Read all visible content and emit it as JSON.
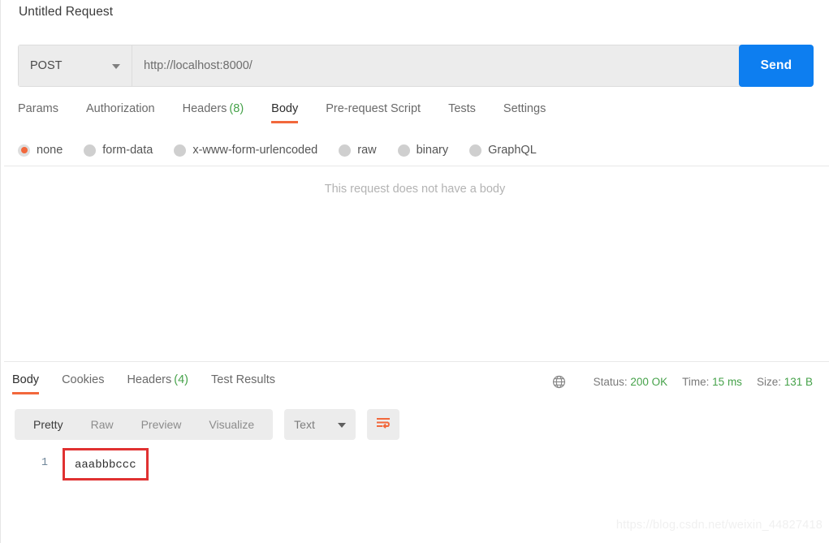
{
  "request": {
    "title": "Untitled Request",
    "method": "POST",
    "method_caret": "chevron-down-icon",
    "url": "http://localhost:8000/",
    "send_label": "Send",
    "send_color": "#0d7ef0",
    "tabs": [
      {
        "label": "Params",
        "count": "",
        "active": false
      },
      {
        "label": "Authorization",
        "count": "",
        "active": false
      },
      {
        "label": "Headers",
        "count": "(8)",
        "active": false
      },
      {
        "label": "Body",
        "count": "",
        "active": true
      },
      {
        "label": "Pre-request Script",
        "count": "",
        "active": false
      },
      {
        "label": "Tests",
        "count": "",
        "active": false
      },
      {
        "label": "Settings",
        "count": "",
        "active": false
      }
    ],
    "body_types": [
      {
        "label": "none",
        "selected": true
      },
      {
        "label": "form-data",
        "selected": false
      },
      {
        "label": "x-www-form-urlencoded",
        "selected": false
      },
      {
        "label": "raw",
        "selected": false
      },
      {
        "label": "binary",
        "selected": false
      },
      {
        "label": "GraphQL",
        "selected": false
      }
    ],
    "empty_body_message": "This request does not have a body"
  },
  "response": {
    "tabs": [
      {
        "label": "Body",
        "count": "",
        "active": true
      },
      {
        "label": "Cookies",
        "count": "",
        "active": false
      },
      {
        "label": "Headers",
        "count": "(4)",
        "active": false
      },
      {
        "label": "Test Results",
        "count": "",
        "active": false
      }
    ],
    "meta": {
      "globe_icon": "globe-icon",
      "status_label": "Status:",
      "status_value": "200 OK",
      "time_label": "Time:",
      "time_value": "15 ms",
      "size_label": "Size:",
      "size_value": "131 B",
      "value_color": "#46a24a"
    },
    "viewer": {
      "modes": [
        {
          "label": "Pretty",
          "active": true
        },
        {
          "label": "Raw",
          "active": false
        },
        {
          "label": "Preview",
          "active": false
        },
        {
          "label": "Visualize",
          "active": false
        }
      ],
      "format": "Text",
      "format_caret": "chevron-down-icon",
      "wrap_icon": "word-wrap-icon"
    },
    "body": {
      "line_number": "1",
      "content": "aaabbbccc",
      "highlight_color": "#e03131"
    }
  },
  "watermark": "https://blog.csdn.net/weixin_44827418",
  "accent_color": "#f2683c"
}
